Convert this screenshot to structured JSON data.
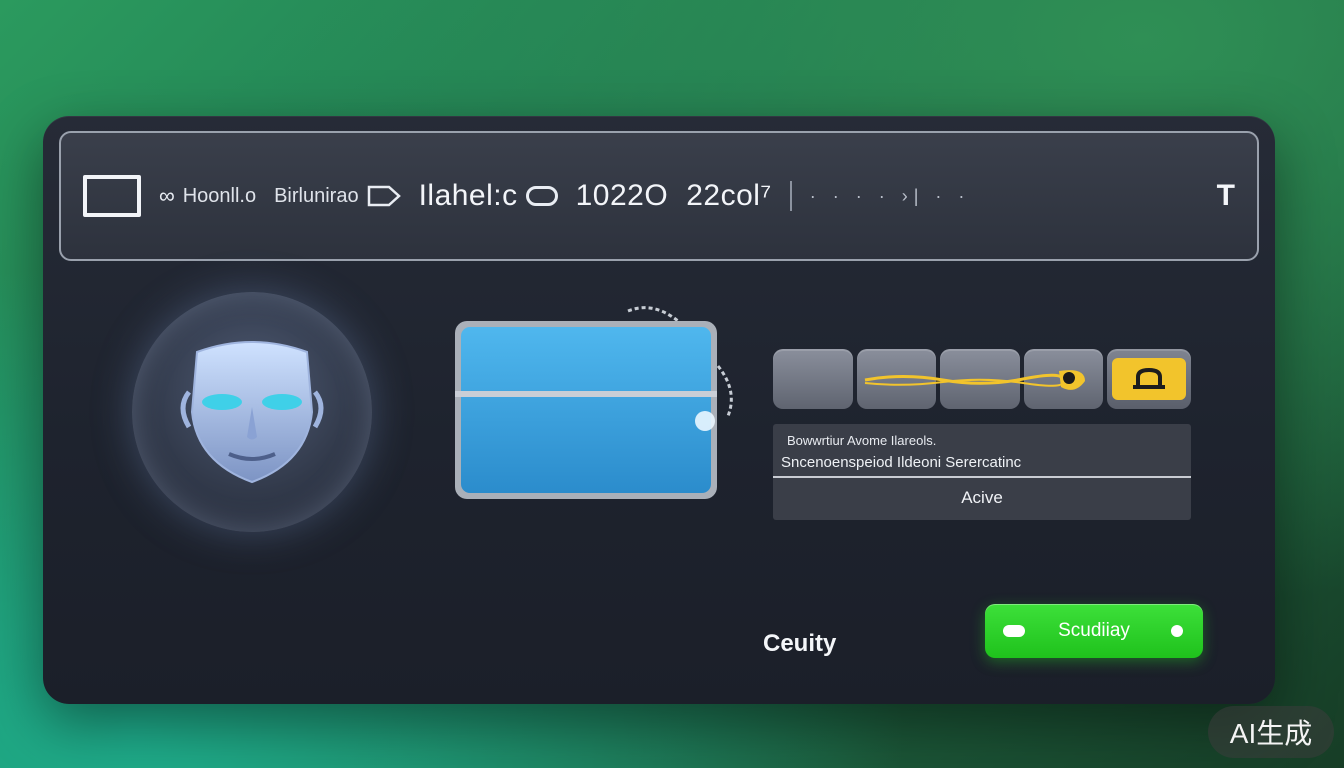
{
  "topbar": {
    "items": [
      {
        "text": "Hoonll.o"
      },
      {
        "text": "Birlunirao"
      },
      {
        "text": "Ilahel:c"
      },
      {
        "text": "1022O"
      },
      {
        "text": "22col⁷"
      }
    ],
    "trailing_icon": "T"
  },
  "progress": {
    "segments_filled": 4,
    "lock_icon": "lock-icon"
  },
  "info": {
    "line1": "Bowwrtiur Avome Ilareols.",
    "line2": "Sncenoenspeiod Ildeoni Serercatinc",
    "status": "Acive"
  },
  "footer": {
    "label": "Ceuity",
    "button_label": "Scudiiay"
  },
  "watermark": "AI生成",
  "colors": {
    "accent_green": "#24c820",
    "lock_yellow": "#f2c42c",
    "wallet_blue": "#3aa0d8"
  }
}
